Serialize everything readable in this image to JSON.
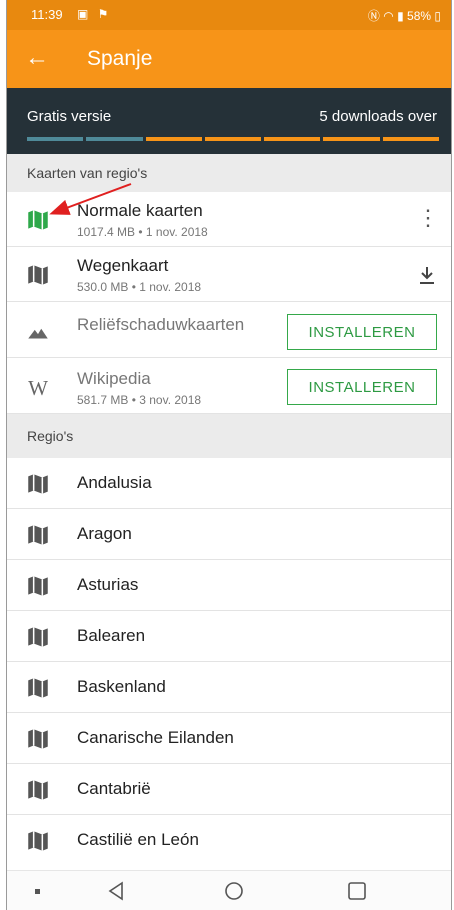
{
  "status": {
    "time": "11:39",
    "battery": "58%"
  },
  "appbar": {
    "title": "Spanje"
  },
  "free_bar": {
    "left_label": "Gratis versie",
    "right_label": "5 downloads over",
    "used_segments": 2,
    "total_segments": 7
  },
  "maps_section": {
    "header": "Kaarten van regio's",
    "items": [
      {
        "title": "Normale kaarten",
        "subtitle": "1017.4 MB • 1 nov. 2018",
        "icon": "map-icon",
        "icon_color": "#2ea84a",
        "action": "more"
      },
      {
        "title": "Wegenkaart",
        "subtitle": "530.0 MB • 1 nov. 2018",
        "icon": "map-icon",
        "action": "download"
      },
      {
        "title": "Reliëfschaduwkaarten",
        "subtitle": "",
        "icon": "mountain-icon",
        "action": "install",
        "action_label": "INSTALLEREN"
      },
      {
        "title": "Wikipedia",
        "subtitle": "581.7 MB • 3 nov. 2018",
        "icon": "wikipedia-icon",
        "icon_glyph": "W",
        "action": "install",
        "action_label": "INSTALLEREN"
      }
    ]
  },
  "regions_section": {
    "header": "Regio's",
    "items": [
      "Andalusia",
      "Aragon",
      "Asturias",
      "Balearen",
      "Baskenland",
      "Canarische Eilanden",
      "Cantabrië",
      "Castilië en León"
    ]
  },
  "colors": {
    "accent": "#f79418",
    "statusbar": "#e8890f",
    "dark_bar": "#253138",
    "progress_used": "#4f8a99",
    "install_green": "#35a84a",
    "annotation_arrow": "#e02020"
  }
}
